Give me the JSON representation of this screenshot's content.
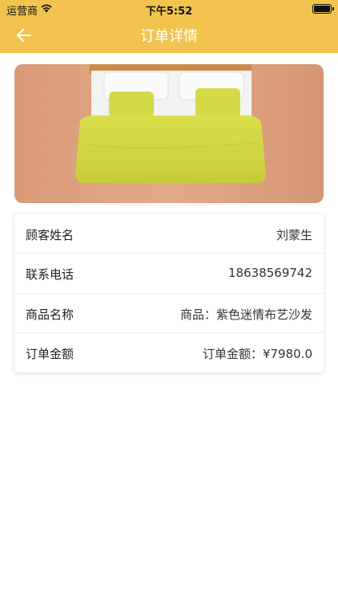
{
  "status_bar": {
    "carrier": "运营商",
    "time": "下午5:52",
    "wifi_icon": "wifi-icon",
    "battery_icon": "battery-icon"
  },
  "nav": {
    "title": "订单详情",
    "back_icon": "arrow-left-icon"
  },
  "colors": {
    "header_bg": "#f2c44f",
    "title_color": "#ffffff"
  },
  "product_image": {
    "description_icon": "bed-image"
  },
  "order_info": [
    {
      "label": "顾客姓名",
      "value": "刘蒙生"
    },
    {
      "label": "联系电话",
      "value": "18638569742"
    },
    {
      "label": "商品名称",
      "value": "商品：紫色迷情布艺沙发"
    },
    {
      "label": "订单金额",
      "value": "订单金额：¥7980.0"
    }
  ]
}
